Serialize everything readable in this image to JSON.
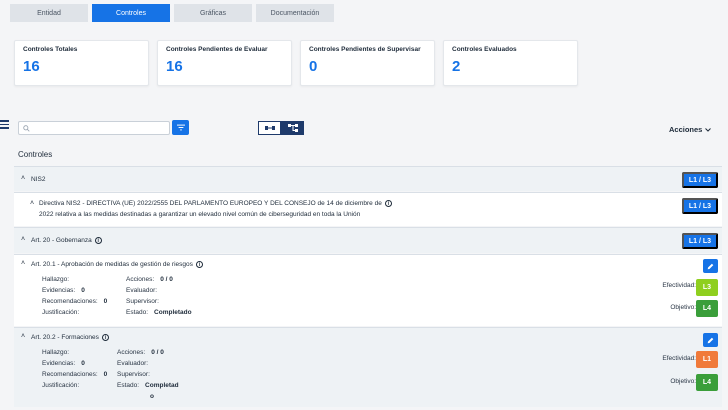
{
  "tabs": [
    {
      "label": "Entidad",
      "active": false
    },
    {
      "label": "Controles",
      "active": true
    },
    {
      "label": "Gráficas",
      "active": false
    },
    {
      "label": "Documentación",
      "active": false
    }
  ],
  "cards": [
    {
      "label": "Controles Totales",
      "value": "16"
    },
    {
      "label": "Controles Pendientes de Evaluar",
      "value": "16"
    },
    {
      "label": "Controles Pendientes de Supervisar",
      "value": "0"
    },
    {
      "label": "Controles Evaluados",
      "value": "2"
    }
  ],
  "search": {
    "placeholder": ""
  },
  "actions_label": "Acciones",
  "section_title": "Controles",
  "colors": {
    "primary": "#1673e6",
    "dark": "#1e3a6b",
    "level_green": "#3a9e3a",
    "level_lime": "#8fcf1f",
    "level_orange": "#f07a3a"
  },
  "tree": {
    "nis2": {
      "label": "NIS2",
      "button": "L1 / L3"
    },
    "directiva": {
      "line1": "Directiva NIS2 - DIRECTIVA (UE) 2022/2555 DEL PARLAMENTO EUROPEO Y DEL CONSEJO de 14 de diciembre de",
      "line2": "2022 relativa a las medidas destinadas a garantizar un elevado nivel común de ciberseguridad en toda la Unión",
      "button": "L1 / L3"
    },
    "art20": {
      "label": "Art. 20 - Gobernanza",
      "button": "L1 / L3"
    },
    "art201": {
      "label": "Art. 20.1 - Aprobación de medidas de gestión de riesgos",
      "hallazgo_label": "Hallazgo:",
      "hallazgo": "",
      "evidencias_label": "Evidencias:",
      "evidencias": "0",
      "recomendaciones_label": "Recomendaciones:",
      "recomendaciones": "0",
      "justificacion_label": "Justificación:",
      "justificacion": "",
      "acciones_label": "Acciones:",
      "acciones": "0 / 0",
      "evaluador_label": "Evaluador:",
      "evaluador": "",
      "supervisor_label": "Supervisor:",
      "supervisor": "",
      "estado_label": "Estado:",
      "estado": "Completado",
      "efectividad_label": "Efectividad:",
      "efectividad": "L3",
      "objetivo_label": "Objetivo:",
      "objetivo": "L4"
    },
    "art202": {
      "label": "Art. 20.2 - Formaciones",
      "hallazgo_label": "Hallazgo:",
      "hallazgo": "",
      "evidencias_label": "Evidencias:",
      "evidencias": "0",
      "recomendaciones_label": "Recomendaciones:",
      "recomendaciones": "0",
      "justificacion_label": "Justificación:",
      "justificacion": "",
      "acciones_label": "Acciones:",
      "acciones": "0 / 0",
      "evaluador_label": "Evaluador:",
      "evaluador": "",
      "supervisor_label": "Supervisor:",
      "supervisor": "",
      "estado_label": "Estado:",
      "estado_line1": "Completad",
      "estado_line2": "o",
      "efectividad_label": "Efectividad:",
      "efectividad": "L1",
      "objetivo_label": "Objetivo:",
      "objetivo": "L4"
    }
  }
}
